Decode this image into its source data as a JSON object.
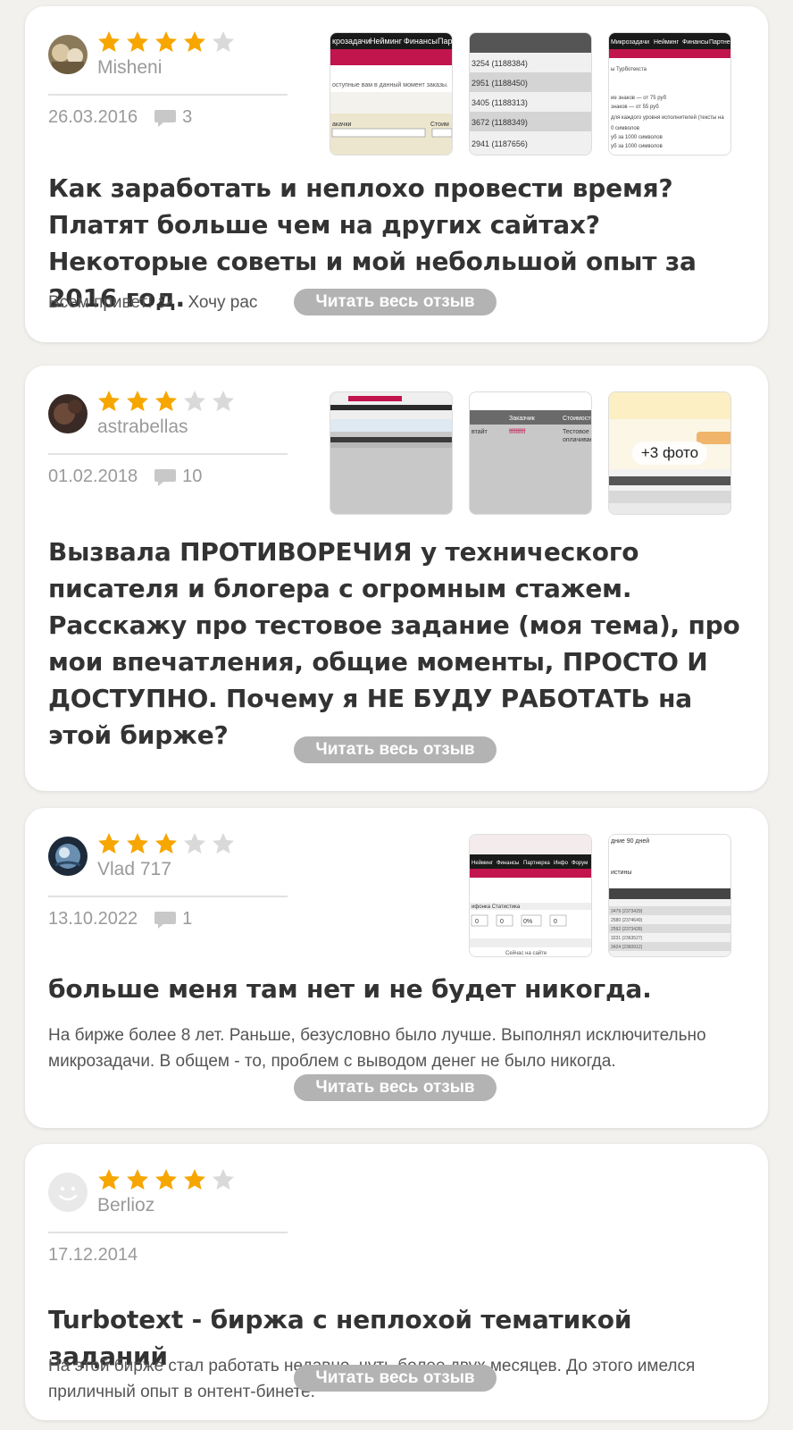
{
  "colors": {
    "background": "#f2f1ed",
    "star_filled": "#f7a600",
    "star_empty": "#d9d9d9",
    "read_more_bg": "#b3b3b3",
    "meta_text": "#9a9a9a"
  },
  "icons": {
    "star": "star-icon",
    "comment": "comment-bubble-icon",
    "avatar_placeholder": "smiley-face-icon"
  },
  "reviews": [
    {
      "username": "Misheni",
      "rating": 4,
      "rating_max": 5,
      "date": "26.03.2016",
      "comments": "3",
      "photos": [
        {
          "label": "Screenshot: Микрозадачи / Нейминг / Финансы / Парт menu, 'оступные вам в данный момент заказы', 'акачки', 'Стоим', 'Не важно'"
        },
        {
          "label": "Screenshot: list '3254 (1188384)', '2951 (1188450)', '3405 (1188313)', '3672 (1188349)', '2941 (1187656)'"
        },
        {
          "label": "Screenshot: 'Микрозадачи Нейминг Финансы Партнерка', 'ы Турботекста', 'для каждого уровня исполнителей (тексты на'"
        }
      ],
      "title": "Как заработать и неплохо провести время? Платят больше чем на других сайтах? Некоторые советы и мой небольшой опыт за 2016 год.",
      "excerpt": "Всем привет! シ   Хочу рас                                              ...",
      "read_more": "Читать весь отзыв"
    },
    {
      "username": "astrabellas",
      "rating": 3,
      "rating_max": 5,
      "date": "01.02.2018",
      "comments": "10",
      "photos": [
        {
          "label": "Screenshot: site table with pink header"
        },
        {
          "label": "Screenshot: table 'Заказчик', 'Стоимость', 'Тестовое зада оплачивается'"
        },
        {
          "label": "Screenshot: orange-yellow form, 'фильтр', 'Список'"
        }
      ],
      "more_photos": "+3 фото",
      "title": "Вызвала ПРОТИВОРЕЧИЯ у технического писателя и блогера с огромным стажем. Расскажу про тестовое задание (моя тема), про мои впечатления, общие моменты, ПРОСТО И ДОСТУПНО. Почему я НЕ БУДУ РАБОТАТЬ на этой бирже?",
      "excerpt": "",
      "read_more": "Читать весь отзыв"
    },
    {
      "username": "Vlad 717",
      "rating": 3,
      "rating_max": 5,
      "date": "13.10.2022",
      "comments": "1",
      "photos": [
        {
          "label": "Screenshot: 'Нейминг Финансы Партнерка Инфо Форум', 'Статистика', '0 0 0% 0', 'Сейчас на сайте'"
        },
        {
          "label": "Screenshot: 'дние 90 дней', 'истины', numbered list"
        }
      ],
      "title": "больше меня там нет и не будет никогда.",
      "excerpt": "На бирже более 8 лет. Раньше, безусловно было лучше. Выполнял исключительно микрозадачи. В общем - то, проблем с выводом денег не было никогда.",
      "read_more": "Читать весь отзыв"
    },
    {
      "username": "Berlioz",
      "rating": 4,
      "rating_max": 5,
      "date": "17.12.2014",
      "comments": "",
      "photos": [],
      "title": "Turbotext - биржа с неплохой тематикой заданий",
      "excerpt": "На этой бирже стал работать недавно, чуть более двух месяцев. До этого имелся приличный опыт в                          онтент-бинете.",
      "read_more": "Читать весь отзыв"
    }
  ]
}
